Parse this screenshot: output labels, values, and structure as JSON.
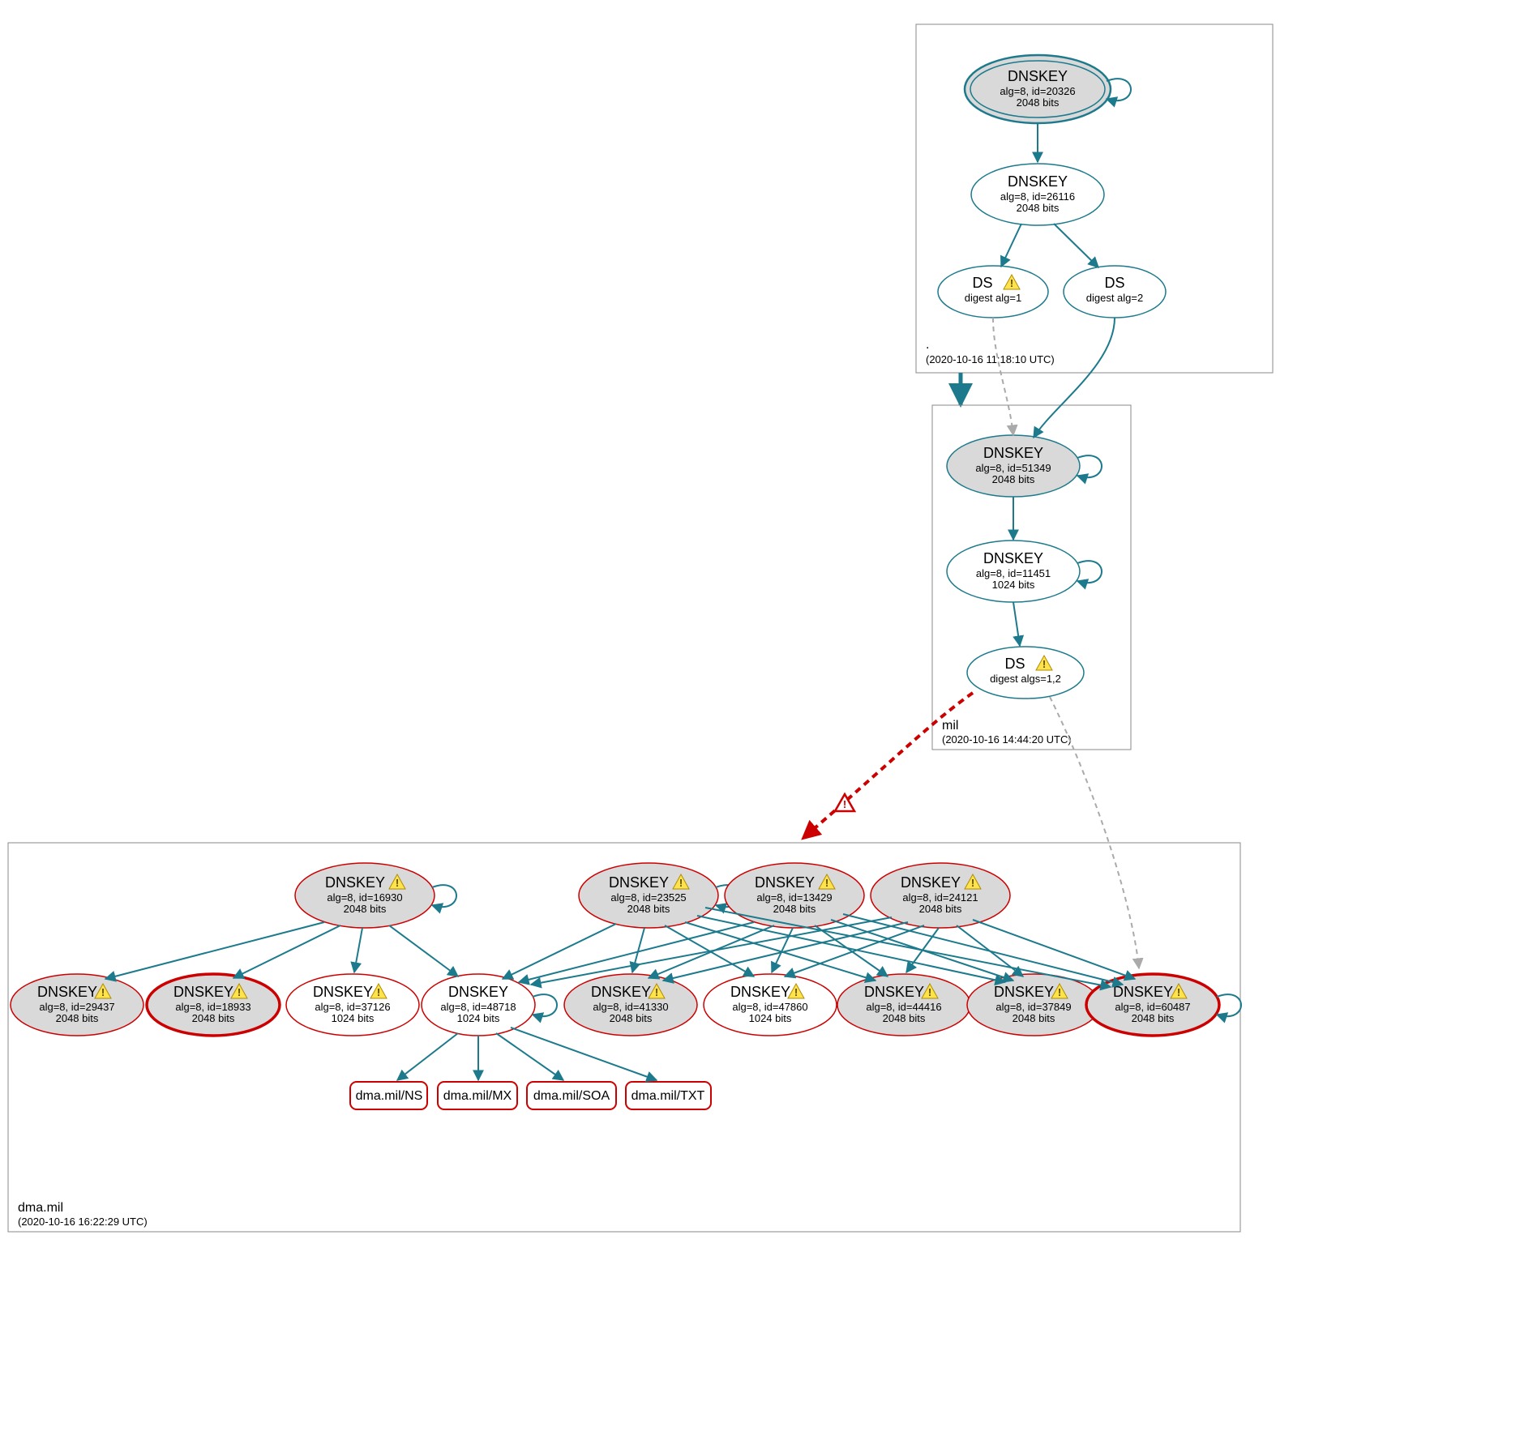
{
  "zones": {
    "root": {
      "label": ".",
      "timestamp": "(2020-10-16 11:18:10 UTC)",
      "nodes": {
        "ksk20326": {
          "title": "DNSKEY",
          "line2": "alg=8, id=20326",
          "line3": "2048 bits"
        },
        "zsk26116": {
          "title": "DNSKEY",
          "line2": "alg=8, id=26116",
          "line3": "2048 bits"
        },
        "ds1": {
          "title": "DS",
          "line2": "digest alg=1"
        },
        "ds2": {
          "title": "DS",
          "line2": "digest alg=2"
        }
      }
    },
    "mil": {
      "label": "mil",
      "timestamp": "(2020-10-16 14:44:20 UTC)",
      "nodes": {
        "ksk51349": {
          "title": "DNSKEY",
          "line2": "alg=8, id=51349",
          "line3": "2048 bits"
        },
        "zsk11451": {
          "title": "DNSKEY",
          "line2": "alg=8, id=11451",
          "line3": "1024 bits"
        },
        "ds12": {
          "title": "DS",
          "line2": "digest algs=1,2"
        }
      }
    },
    "dma": {
      "label": "dma.mil",
      "timestamp": "(2020-10-16 16:22:29 UTC)",
      "ksks": {
        "k16930": {
          "title": "DNSKEY",
          "line2": "alg=8, id=16930",
          "line3": "2048 bits"
        },
        "k23525": {
          "title": "DNSKEY",
          "line2": "alg=8, id=23525",
          "line3": "2048 bits"
        },
        "k13429": {
          "title": "DNSKEY",
          "line2": "alg=8, id=13429",
          "line3": "2048 bits"
        },
        "k24121": {
          "title": "DNSKEY",
          "line2": "alg=8, id=24121",
          "line3": "2048 bits"
        }
      },
      "zsks": {
        "z29437": {
          "title": "DNSKEY",
          "line2": "alg=8, id=29437",
          "line3": "2048 bits"
        },
        "z18933": {
          "title": "DNSKEY",
          "line2": "alg=8, id=18933",
          "line3": "2048 bits"
        },
        "z37126": {
          "title": "DNSKEY",
          "line2": "alg=8, id=37126",
          "line3": "1024 bits"
        },
        "z48718": {
          "title": "DNSKEY",
          "line2": "alg=8, id=48718",
          "line3": "1024 bits"
        },
        "z41330": {
          "title": "DNSKEY",
          "line2": "alg=8, id=41330",
          "line3": "2048 bits"
        },
        "z47860": {
          "title": "DNSKEY",
          "line2": "alg=8, id=47860",
          "line3": "1024 bits"
        },
        "z44416": {
          "title": "DNSKEY",
          "line2": "alg=8, id=44416",
          "line3": "2048 bits"
        },
        "z37849": {
          "title": "DNSKEY",
          "line2": "alg=8, id=37849",
          "line3": "2048 bits"
        },
        "z60487": {
          "title": "DNSKEY",
          "line2": "alg=8, id=60487",
          "line3": "2048 bits"
        }
      },
      "rrsets": {
        "ns": "dma.mil/NS",
        "mx": "dma.mil/MX",
        "soa": "dma.mil/SOA",
        "txt": "dma.mil/TXT"
      }
    }
  }
}
